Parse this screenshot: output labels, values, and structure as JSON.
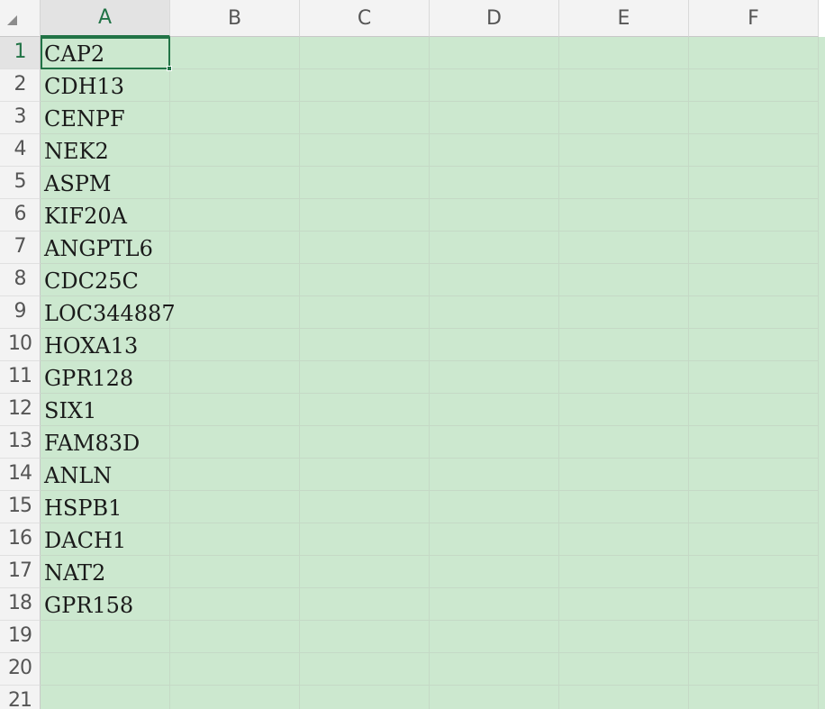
{
  "sheet": {
    "columns": [
      "A",
      "B",
      "C",
      "D",
      "E",
      "F"
    ],
    "active_column": "A",
    "active_row": 1,
    "rows": [
      {
        "num": "1",
        "a": "CAP2"
      },
      {
        "num": "2",
        "a": "CDH13"
      },
      {
        "num": "3",
        "a": "CENPF"
      },
      {
        "num": "4",
        "a": "NEK2"
      },
      {
        "num": "5",
        "a": "ASPM"
      },
      {
        "num": "6",
        "a": "KIF20A"
      },
      {
        "num": "7",
        "a": "ANGPTL6"
      },
      {
        "num": "8",
        "a": "CDC25C"
      },
      {
        "num": "9",
        "a": "LOC344887"
      },
      {
        "num": "10",
        "a": "HOXA13"
      },
      {
        "num": "11",
        "a": "GPR128"
      },
      {
        "num": "12",
        "a": "SIX1"
      },
      {
        "num": "13",
        "a": "FAM83D"
      },
      {
        "num": "14",
        "a": "ANLN"
      },
      {
        "num": "15",
        "a": "HSPB1"
      },
      {
        "num": "16",
        "a": "DACH1"
      },
      {
        "num": "17",
        "a": "NAT2"
      },
      {
        "num": "18",
        "a": "GPR158"
      },
      {
        "num": "19",
        "a": ""
      },
      {
        "num": "20",
        "a": ""
      },
      {
        "num": "21",
        "a": ""
      }
    ]
  },
  "colors": {
    "accent": "#217346",
    "cell_background": "#cce8cf",
    "header_background": "#f3f3f3"
  }
}
